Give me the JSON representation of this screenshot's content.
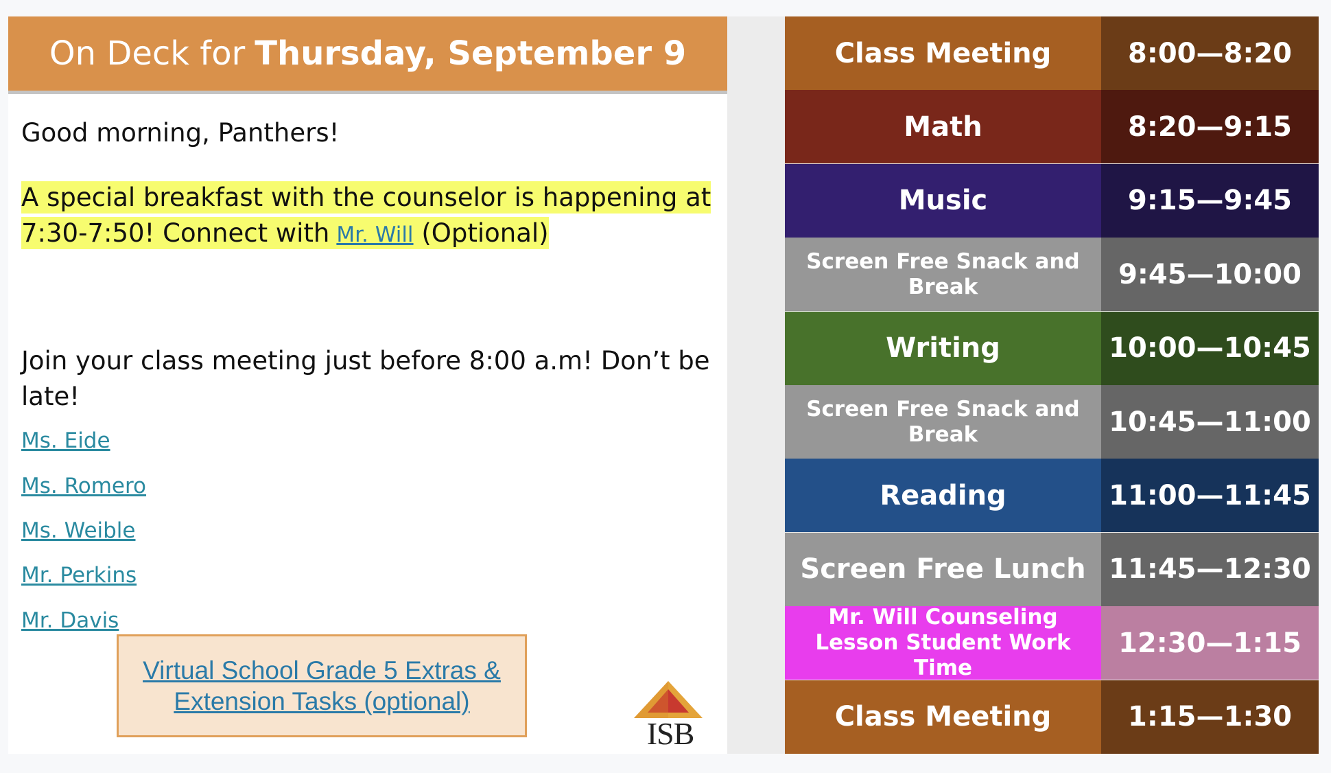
{
  "header": {
    "prefix": "On Deck for",
    "date": "Thursday, September 9"
  },
  "body": {
    "greeting": "Good morning, Panthers!",
    "breakfast_text": "A special breakfast with the counselor is happening at 7:30-7:50! Connect with",
    "breakfast_link": "Mr. Will",
    "breakfast_suffix": "(Optional)",
    "join_text": "Join your class meeting just before 8:00 a.m! Don’t be late!",
    "teachers": [
      "Ms. Eide",
      "Ms. Romero",
      "Ms. Weible",
      "Mr. Perkins",
      "Mr. Davis"
    ],
    "extras_line1": "Virtual School Grade 5 Extras &",
    "extras_line2": "Extension Tasks (optional)",
    "logo_text": "ISB"
  },
  "schedule": [
    {
      "subject": "Class Meeting",
      "time": "8:00—8:20",
      "subject_color": "#a65f22",
      "time_color": "#6b3c17"
    },
    {
      "subject": "Math",
      "time": "8:20—9:15",
      "subject_color": "#79271a",
      "time_color": "#4e190f"
    },
    {
      "subject": "Music",
      "time": "9:15—9:45",
      "subject_color": "#331f6f",
      "time_color": "#1f1545"
    },
    {
      "subject": "Screen Free Snack and Break",
      "time": "9:45—10:00",
      "subject_color": "#979797",
      "time_color": "#666666"
    },
    {
      "subject": "Writing",
      "time": "10:00—10:45",
      "subject_color": "#48722b",
      "time_color": "#2f4c1d"
    },
    {
      "subject": "Screen Free Snack and Break",
      "time": "10:45—11:00",
      "subject_color": "#979797",
      "time_color": "#666666"
    },
    {
      "subject": "Reading",
      "time": "11:00—11:45",
      "subject_color": "#235089",
      "time_color": "#16335a"
    },
    {
      "subject": "Screen Free Lunch",
      "time": "11:45—12:30",
      "subject_color": "#979797",
      "time_color": "#666666"
    },
    {
      "subject": "Mr. Will Counseling Lesson Student Work Time",
      "time": "12:30—1:15",
      "subject_color": "#e83ded",
      "time_color": "#bb7fa1"
    },
    {
      "subject": "Class Meeting",
      "time": "1:15—1:30",
      "subject_color": "#a65f22",
      "time_color": "#6b3c17"
    }
  ]
}
